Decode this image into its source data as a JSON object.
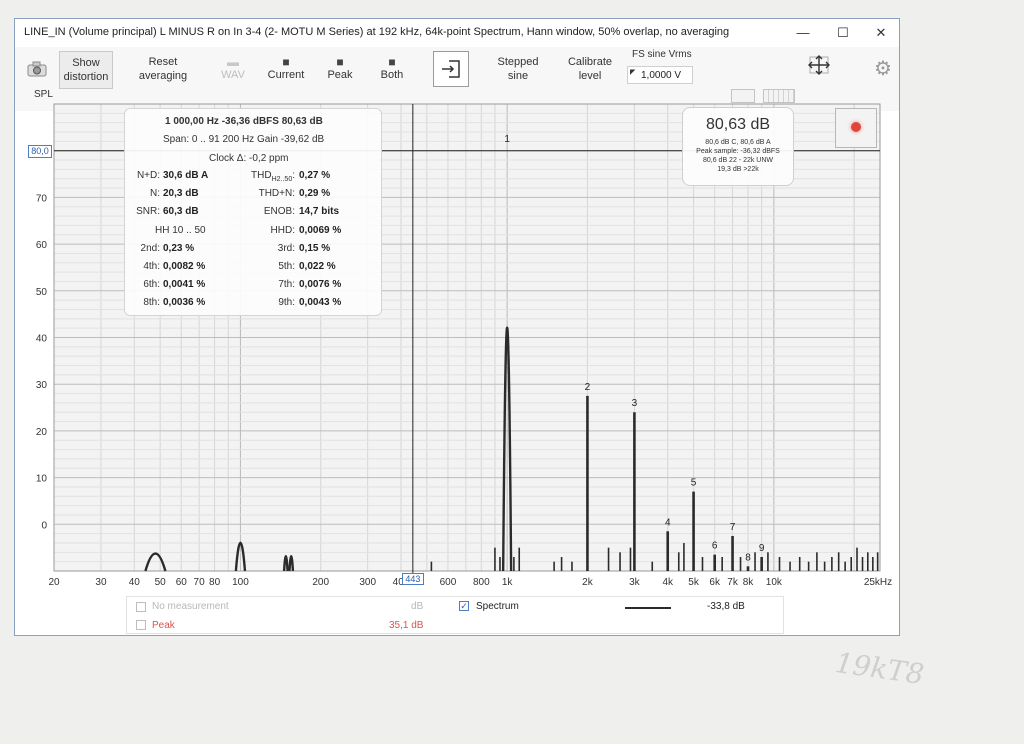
{
  "window": {
    "title": "LINE_IN (Volume principal) L MINUS R on In 3-4 (2- MOTU M Series) at 192 kHz, 64k-point Spectrum, Hann window, 50% overlap, no averaging",
    "controls": {
      "minimize": "—",
      "maximize": "☐",
      "close": "✕"
    }
  },
  "toolbar": {
    "show_distortion": "Show\ndistortion",
    "reset_averaging": "Reset\naveraging",
    "wav": "WAV",
    "current": "Current",
    "peak": "Peak",
    "both": "Both",
    "stepped_sine": "Stepped\nsine",
    "calibrate_level": "Calibrate\nlevel",
    "fs_label": "FS sine Vrms",
    "fs_value": "1,0000 V",
    "spl": "SPL"
  },
  "stats": {
    "line1": "1 000,00 Hz  -36,36 dBFS  80,63 dB",
    "line2": "Span: 0 .. 91 200 Hz  Gain -39,62 dB",
    "clock": "Clock Δ: -0,2 ppm",
    "rows": [
      {
        "l1": "N+D:",
        "v1": "30,6 dB A",
        "l2": "THD",
        "sub2": "H2..50",
        "v2": "0,27 %"
      },
      {
        "l1": "N:",
        "v1": "20,3 dB",
        "l2": "THD+N:",
        "v2": "0,29 %"
      },
      {
        "l1": "SNR:",
        "v1": "60,3 dB",
        "l2": "ENOB:",
        "v2": "14,7 bits"
      },
      {
        "l1": "HH 10 .. 50",
        "v1": "",
        "l2": "HHD:",
        "v2": "0,0069 %"
      },
      {
        "l1": "2nd:",
        "v1": "0,23 %",
        "l2": "3rd:",
        "v2": "0,15 %"
      },
      {
        "l1": "4th:",
        "v1": "0,0082 %",
        "l2": "5th:",
        "v2": "0,022 %"
      },
      {
        "l1": "6th:",
        "v1": "0,0041 %",
        "l2": "7th:",
        "v2": "0,0076 %"
      },
      {
        "l1": "8th:",
        "v1": "0,0036 %",
        "l2": "9th:",
        "v2": "0,0043 %"
      }
    ]
  },
  "level": {
    "main": "80,63 dB",
    "lines": [
      "80,6 dB C, 80,6 dB A",
      "Peak sample: -36,32 dBFS",
      "80,6 dB 22 - 22k UNW",
      "19,3 dB >22k"
    ]
  },
  "cursor": {
    "freq_box": "443",
    "level_box": "80,0"
  },
  "legend": {
    "no_measurement": "No measurement",
    "no_measurement_unit": "dB",
    "peak": "Peak",
    "peak_value": "35,1 dB",
    "spectrum": "Spectrum",
    "spectrum_value": "-33,8 dB"
  },
  "margin_note": "19kT8",
  "chart_data": {
    "type": "line",
    "title": "",
    "xlabel": "",
    "ylabel": "SPL",
    "x_scale": "log",
    "xlim": [
      20,
      25000
    ],
    "ylim": [
      -10,
      90
    ],
    "grid": true,
    "x_ticks": [
      {
        "v": 20,
        "t": "20"
      },
      {
        "v": 30,
        "t": "30"
      },
      {
        "v": 40,
        "t": "40"
      },
      {
        "v": 50,
        "t": "50"
      },
      {
        "v": 60,
        "t": "60"
      },
      {
        "v": 70,
        "t": "70"
      },
      {
        "v": 80,
        "t": "80"
      },
      {
        "v": 100,
        "t": "100"
      },
      {
        "v": 200,
        "t": "200"
      },
      {
        "v": 300,
        "t": "300"
      },
      {
        "v": 400,
        "t": "400"
      },
      {
        "v": 600,
        "t": "600"
      },
      {
        "v": 800,
        "t": "800"
      },
      {
        "v": 1000,
        "t": "1k"
      },
      {
        "v": 2000,
        "t": "2k"
      },
      {
        "v": 3000,
        "t": "3k"
      },
      {
        "v": 4000,
        "t": "4k"
      },
      {
        "v": 5000,
        "t": "5k"
      },
      {
        "v": 6000,
        "t": "6k"
      },
      {
        "v": 7000,
        "t": "7k"
      },
      {
        "v": 8000,
        "t": "8k"
      },
      {
        "v": 10000,
        "t": "10k"
      },
      {
        "v": 25000,
        "t": "25kHz"
      }
    ],
    "y_ticks": [
      0,
      10,
      20,
      30,
      40,
      50,
      60,
      70
    ],
    "cursor_x": 443,
    "cursor_y": 80,
    "series": [
      {
        "color": "#2b2b2b",
        "peaks": [
          {
            "f": 48,
            "level": -3.5,
            "w": 1.09
          },
          {
            "f": 100,
            "level": 0.5,
            "w": 1.04
          },
          {
            "f": 148,
            "level": -4.5,
            "w": 1.015
          },
          {
            "f": 155,
            "level": -4.5,
            "w": 1.015
          },
          {
            "f": 1000,
            "level": 80.6,
            "w": 1.035
          },
          {
            "f": 2000,
            "level": 27.5,
            "w": 1.004
          },
          {
            "f": 3000,
            "level": 24,
            "w": 1.004
          },
          {
            "f": 4000,
            "level": -1.5,
            "w": 1.004
          },
          {
            "f": 5000,
            "level": 7,
            "w": 1.004
          },
          {
            "f": 6000,
            "level": -6.5,
            "w": 1.004
          },
          {
            "f": 7000,
            "level": -2.5,
            "w": 1.004
          },
          {
            "f": 8000,
            "level": -9,
            "w": 1.004
          },
          {
            "f": 9000,
            "level": -7,
            "w": 1.004
          }
        ],
        "noise_lines": [
          {
            "f": 520,
            "level": -8
          },
          {
            "f": 900,
            "level": -5
          },
          {
            "f": 940,
            "level": -7
          },
          {
            "f": 1060,
            "level": -7
          },
          {
            "f": 1110,
            "level": -5
          },
          {
            "f": 1500,
            "level": -8
          },
          {
            "f": 1600,
            "level": -7
          },
          {
            "f": 1750,
            "level": -8
          },
          {
            "f": 2400,
            "level": -5
          },
          {
            "f": 2650,
            "level": -6
          },
          {
            "f": 2900,
            "level": -5
          },
          {
            "f": 3500,
            "level": -8
          },
          {
            "f": 4400,
            "level": -6
          },
          {
            "f": 4600,
            "level": -4
          },
          {
            "f": 5400,
            "level": -7
          },
          {
            "f": 6400,
            "level": -7
          },
          {
            "f": 7500,
            "level": -7
          },
          {
            "f": 8500,
            "level": -6
          },
          {
            "f": 9500,
            "level": -6
          },
          {
            "f": 10500,
            "level": -7
          },
          {
            "f": 11500,
            "level": -8
          },
          {
            "f": 12500,
            "level": -7
          },
          {
            "f": 13500,
            "level": -8
          },
          {
            "f": 14500,
            "level": -6
          },
          {
            "f": 15500,
            "level": -8
          },
          {
            "f": 16500,
            "level": -7
          },
          {
            "f": 17500,
            "level": -6
          },
          {
            "f": 18500,
            "level": -8
          },
          {
            "f": 19500,
            "level": -7
          },
          {
            "f": 20500,
            "level": -5
          },
          {
            "f": 21500,
            "level": -7
          },
          {
            "f": 22500,
            "level": -6
          },
          {
            "f": 23500,
            "level": -7
          },
          {
            "f": 24500,
            "level": -6
          }
        ]
      }
    ],
    "harmonic_labels": [
      {
        "n": "1",
        "f": 1000,
        "level": 80.6
      },
      {
        "n": "2",
        "f": 2000,
        "level": 27.5
      },
      {
        "n": "3",
        "f": 3000,
        "level": 24
      },
      {
        "n": "4",
        "f": 4000,
        "level": -1.5
      },
      {
        "n": "5",
        "f": 5000,
        "level": 7
      },
      {
        "n": "6",
        "f": 6000,
        "level": -6.5
      },
      {
        "n": "7",
        "f": 7000,
        "level": -2.5
      },
      {
        "n": "8",
        "f": 8000,
        "level": -9
      },
      {
        "n": "9",
        "f": 9000,
        "level": -7
      }
    ]
  }
}
